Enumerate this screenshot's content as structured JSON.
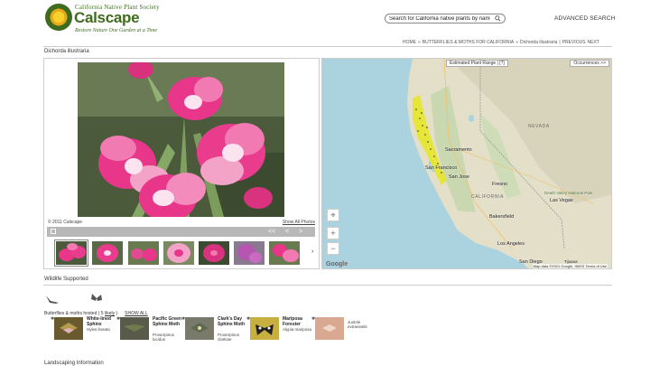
{
  "header": {
    "org_name": "California Native Plant Society",
    "brand": "Calscape",
    "tagline": "Restore Nature One Garden at a Time",
    "search_placeholder": "Search for California native plants by name",
    "advanced_search": "ADVANCED SEARCH"
  },
  "breadcrumb": [
    "HOME",
    "»",
    "BUTTERFLIES & MOTHS FOR CALIFORNIA",
    "»",
    "Dichorda illustraria",
    "|",
    "PREVIOUS",
    "NEXT"
  ],
  "species_title": "Dichorda illustraria",
  "photo": {
    "copyright": "© 2011 Calscape",
    "show_all_photos": "Show All Photos",
    "nav": [
      "<<",
      "<",
      ">"
    ],
    "thumb_more": "›"
  },
  "map": {
    "range_button": "Estimated Plant Range | [?]",
    "occurrences_button": "Occurrences >>",
    "zoom_in": "+",
    "zoom_out": "−",
    "locate_icon": "crosshair-icon",
    "google": "Google",
    "attribution": "Map data ©2021 Google, INEGI  Terms of Use",
    "states": [
      "NEVADA",
      "CALIFORNIA"
    ],
    "cities": [
      "Sacramento",
      "San Francisco",
      "San Jose",
      "Fresno",
      "Death Valley National Park",
      "Las Vegas",
      "Bakersfield",
      "Los Angeles",
      "San Diego",
      "Tijuana"
    ],
    "range_color": "#e6e62a"
  },
  "wildlife": {
    "title": "Wildlife Supported",
    "bird_icon": "bird-icon",
    "butterfly_icon": "butterfly-icon",
    "bf_header_prefix": "Butterflies & moths hosted ( 5 ",
    "bf_likely": "likely",
    "bf_header_suffix": " )",
    "show_all": "SHOW ALL",
    "species": [
      {
        "name": "White-lined Sphinx",
        "sci": "Hyles lineata"
      },
      {
        "name": "Pacific Green Sphinx Moth",
        "sci": "Proserpinus lucidus"
      },
      {
        "name": "Clark's Day Sphinx Moth",
        "sci": "Proserpinus clarkiae"
      },
      {
        "name": "Mariposa Forester",
        "sci": "Alypia mariposa"
      },
      {
        "name": "",
        "sci": "Juxtole extranealis"
      }
    ]
  },
  "landscaping": "Landscaping Information"
}
